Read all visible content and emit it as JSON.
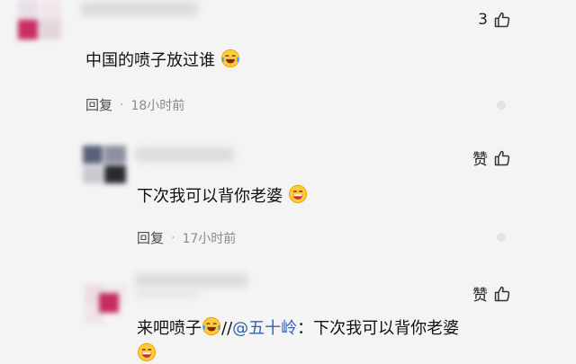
{
  "comments": [
    {
      "text": "中国的喷子放过谁",
      "reply_label": "回复",
      "time": "18小时前",
      "like_label": "3",
      "emoji": "laugh-cry-emoji"
    },
    {
      "text": "下次我可以背你老婆",
      "reply_label": "回复",
      "time": "17小时前",
      "like_label": "赞",
      "emoji": "grin-emoji"
    },
    {
      "text_prefix": "来吧喷子",
      "separator": "//",
      "mention": "@五十岭",
      "quote_sep": "：",
      "quote_text": "下次我可以背你老婆",
      "like_label": "赞",
      "emoji_a": "laugh-cry-emoji",
      "emoji_b": "grin-emoji"
    }
  ],
  "colors": {
    "background": "#f4f4f5",
    "meta_text": "#8a8a8f",
    "mention": "#2f5fb3"
  }
}
